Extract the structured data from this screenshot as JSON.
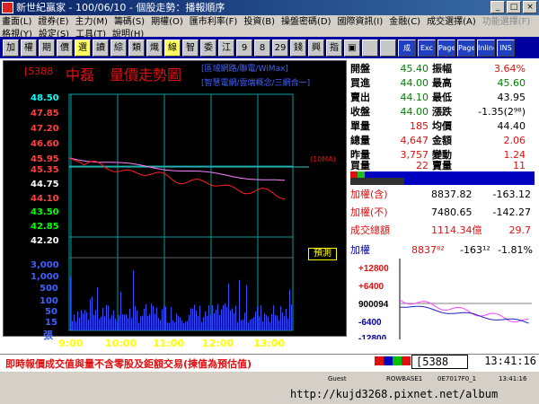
{
  "window": {
    "title": "新世紀贏家 - 100/06/10 - 個股走勢：播報順序"
  },
  "menu": {
    "row1": [
      "畫面(L)",
      "證券(E)",
      "主力(M)",
      "籌碼(S)",
      "期權(O)",
      "匯市利率(F)",
      "投資(B)",
      "操盤密碼(D)",
      "國際資訊(I)",
      "金融(C)",
      "成交選擇(A)",
      "功能選擇(F)"
    ],
    "row2": [
      "格視(Y)",
      "設定(S)",
      "工具(T)",
      "說明(H)"
    ]
  },
  "toolbar": {
    "buttons": [
      "加",
      "權",
      "期",
      "價",
      "選",
      "讀",
      "綜",
      "類",
      "熾",
      "線",
      "智",
      "委",
      "江",
      "9",
      "8",
      "29",
      "錢",
      "興",
      "指",
      "▣",
      "",
      ""
    ],
    "icons": [
      "成",
      "Exc",
      "Page",
      "Page",
      "Inline",
      "INS"
    ]
  },
  "chart": {
    "stock_code": "[5388",
    "stock_name": "中磊",
    "title": "量價走勢圖",
    "tags_line1": "[區域網路/聯電/WiMax]",
    "tags_line2": "[智慧電網/雲端概念/三網合一]",
    "ref_label": "(10MA)",
    "predict_label": "預測",
    "zhang_label": "張",
    "price_labels": [
      "48.50",
      "47.85",
      "47.20",
      "46.60",
      "45.95",
      "45.35",
      "44.75",
      "44.10",
      "43.50",
      "42.85",
      "42.20"
    ],
    "price_colors": [
      "#00ffff",
      "#ff4040",
      "#ff4040",
      "#ff4040",
      "#ff4040",
      "#ff4040",
      "#ffffff",
      "#ff4040",
      "#00ff00",
      "#00ff00",
      "#ffffff"
    ],
    "volume_labels": [
      "3,000",
      "1,000",
      "500",
      "100",
      "50",
      "15"
    ],
    "time_labels": [
      "9:00",
      "10:00",
      "11:00",
      "12:00",
      "13:00"
    ]
  },
  "chart_data": {
    "type": "line",
    "x": [
      "9:00",
      "10:00",
      "11:00",
      "12:00",
      "13:00",
      "13:30"
    ],
    "ylim": [
      42.2,
      48.5
    ],
    "series": [],
    "volume_unit": "張"
  },
  "quote": {
    "open_label": "開盤",
    "open_val": "45.40",
    "amp_label": "振幅",
    "amp_val": "3.64%",
    "bid_label": "買進",
    "bid_val": "44.00",
    "high_label": "最高",
    "high_val": "45.60",
    "ask_label": "賣出",
    "ask_val": "44.10",
    "low_label": "最低",
    "low_val": "43.95",
    "close_label": "收盤",
    "close_val": "44.00",
    "chg_label": "漲跌",
    "chg_val": "-1.35(2⁹⁸)",
    "single_label": "單量",
    "single_val": "185",
    "avg_label": "均價",
    "avg_val": "44.40",
    "totvol_label": "總量",
    "totvol_val": "4,647",
    "amount_label": "金額",
    "amount_val": "2.06",
    "yvol_label": "昨量",
    "yvol_val": "3,757",
    "turn_label": "變動",
    "turn_val": "1.24",
    "buyvol_label": "買量",
    "buyvol_val": "22",
    "sellvol_label": "賣量",
    "sellvol_val": "11"
  },
  "index": {
    "r1_label": "加權(含)",
    "r1_val": "8837.82",
    "r1_chg": "-163.12",
    "r2_label": "加權(不)",
    "r2_val": "7480.65",
    "r2_chg": "-142.27",
    "r3_label": "成交總額",
    "r3_val": "1114.34億",
    "r3_chg": "29.7"
  },
  "mini": {
    "label": "加權",
    "val": "8837⁸²",
    "chg": "-163¹²",
    "pct": "-1.81%",
    "yticks": [
      "+12800",
      "+6400",
      "900094",
      "-6400",
      "-12800"
    ]
  },
  "status": {
    "notice": "即時報價成交值與量不含零股及鉅額交易(揀值為預估值)",
    "code": "[5388",
    "clock": "13:41:16",
    "bottom": [
      "Guest",
      "ROWBASE1",
      "0E7017F0_1",
      "13:41:16"
    ],
    "watermark": "http://kujd3268.pixnet.net/album"
  },
  "colors": {
    "red": "#e01010",
    "green": "#008000",
    "blue": "#0000a0",
    "yellow": "#ffff00",
    "cyan": "#00ffff"
  }
}
